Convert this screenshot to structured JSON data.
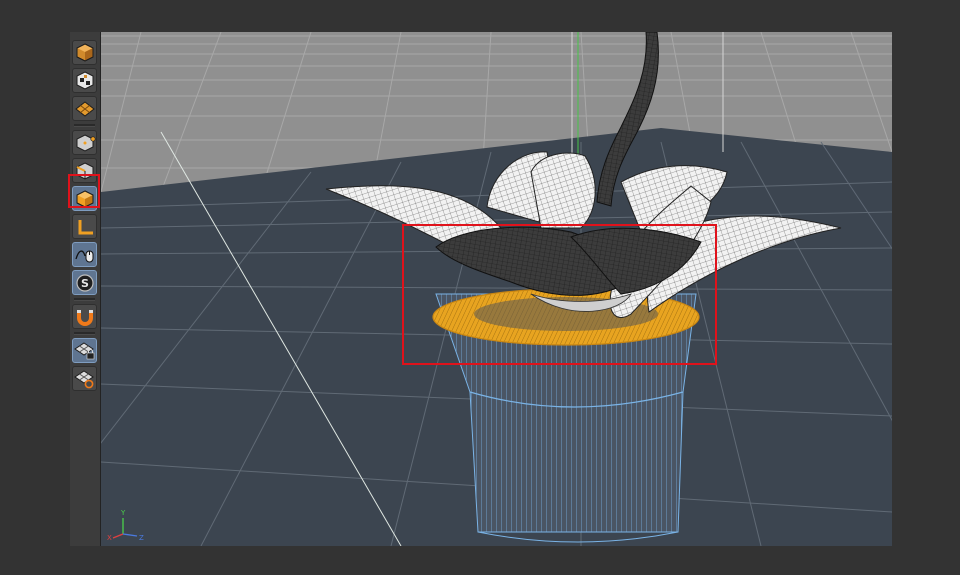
{
  "viewport": {
    "axis_labels": {
      "x": "X",
      "y": "Y",
      "z": "Z"
    },
    "colors": {
      "floor_back": "#8c8c8c",
      "floor_front": "#3d4550",
      "grid_line": "#b9b9b9",
      "pot_wire": "#6fa8dc",
      "pot_top_fill": "#e8a420",
      "selection_red": "#e0121b",
      "leaf_fill": "#e9e9e9"
    }
  },
  "toolbar": {
    "tools": [
      {
        "name": "model-mode",
        "icon": "cube-icon",
        "active": false
      },
      {
        "name": "texture-mode",
        "icon": "checker-cube-icon",
        "active": false
      },
      {
        "name": "workplane-mode",
        "icon": "grid-plane-icon",
        "active": false
      },
      {
        "name": "points-mode",
        "icon": "cube-points-icon",
        "active": false
      },
      {
        "name": "edges-mode",
        "icon": "cube-edges-icon",
        "active": false
      },
      {
        "name": "polygons-mode",
        "icon": "cube-polygons-icon",
        "active": true
      },
      {
        "name": "axis-mode",
        "icon": "axis-icon",
        "active": false
      },
      {
        "name": "tweak-mode",
        "icon": "mouse-spline-icon",
        "active": false
      },
      {
        "name": "solo-mode",
        "icon": "s-badge-icon",
        "active": false
      },
      {
        "name": "snap",
        "icon": "magnet-icon",
        "active": false
      },
      {
        "name": "locked-workplane",
        "icon": "grid-lock-icon",
        "active": false
      },
      {
        "name": "planar-workplane",
        "icon": "grid-refresh-icon",
        "active": false
      }
    ]
  }
}
